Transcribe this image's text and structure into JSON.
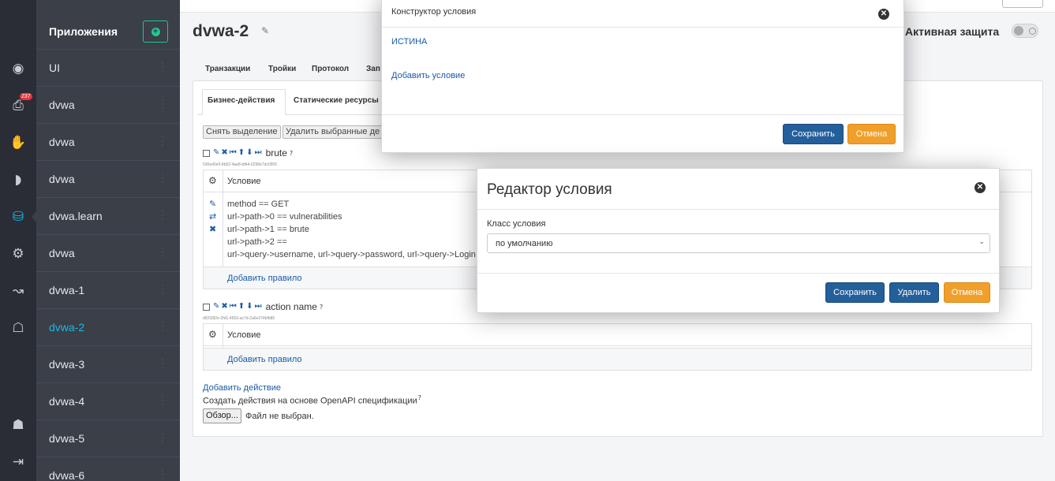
{
  "rail": {
    "icons": [
      "eye-icon",
      "notifications-icon",
      "hand-icon",
      "signal-icon",
      "database-icon",
      "settings-gear-icon",
      "analytics-icon",
      "learning-icon",
      "user-icon",
      "logout-icon"
    ],
    "badge": "237"
  },
  "apps": {
    "title": "Приложения",
    "add_glyph": "+",
    "items": [
      {
        "label": "UI",
        "active": false
      },
      {
        "label": "dvwa",
        "active": false
      },
      {
        "label": "dvwa",
        "active": false
      },
      {
        "label": "dvwa",
        "active": false
      },
      {
        "label": "dvwa.learn",
        "active": false
      },
      {
        "label": "dvwa",
        "active": false
      },
      {
        "label": "dvwa-1",
        "active": false
      },
      {
        "label": "dvwa-2",
        "active": true
      },
      {
        "label": "dvwa-3",
        "active": false
      },
      {
        "label": "dvwa-4",
        "active": false
      },
      {
        "label": "dvwa-5",
        "active": false
      },
      {
        "label": "dvwa-6",
        "active": false
      }
    ]
  },
  "header": {
    "title": "dvwa-2",
    "active_protection": "Активная защита",
    "active_protection_on": false
  },
  "tabs": [
    "Транзакции",
    "Тройки",
    "Протокол",
    "Зап"
  ],
  "sub_tabs": {
    "active": "Бизнес-действия",
    "other": "Статические ресурсы"
  },
  "toolbar": {
    "deselect": "Снять выделение",
    "delete_selected": "Удалить выбранные де"
  },
  "actions": [
    {
      "name": "brute",
      "guid": "530ed0e9-8b52-4ae8-bfb4-0298e7dc0955",
      "condition_header": "Условие",
      "rules": [
        "method == GET",
        "url->path->0 == vulnerabilities",
        "url->path->1 == brute",
        "url->path->2 ==",
        "url->query->username, url->query->password, url->query->Login"
      ],
      "add_rule": "Добавить правило"
    },
    {
      "name": "action name",
      "guid": "df20282e-2fd1-4653-ac7d-2a6e374bfb85",
      "condition_header": "Условие",
      "rules": [],
      "add_rule": "Добавить правило"
    }
  ],
  "footer": {
    "add_action": "Добавить действие",
    "openapi": "Создать действия на основе OpenAPI спецификации",
    "browse": "Обзор...",
    "no_file": "Файл не выбран."
  },
  "modal_condition_builder": {
    "title": "Конструктор условия",
    "expression": "ИСТИНА",
    "add_condition": "Добавить условие",
    "save": "Сохранить",
    "cancel": "Отмена"
  },
  "modal_condition_editor": {
    "title": "Редактор условия",
    "class_label": "Класс условия",
    "class_value": "по умолчанию",
    "save": "Сохранить",
    "delete": "Удалить",
    "cancel": "Отмена"
  },
  "colors": {
    "accent": "#1ab8e8",
    "primary": "#235f9b",
    "warning": "#f0a02a",
    "add": "#22c78e"
  }
}
